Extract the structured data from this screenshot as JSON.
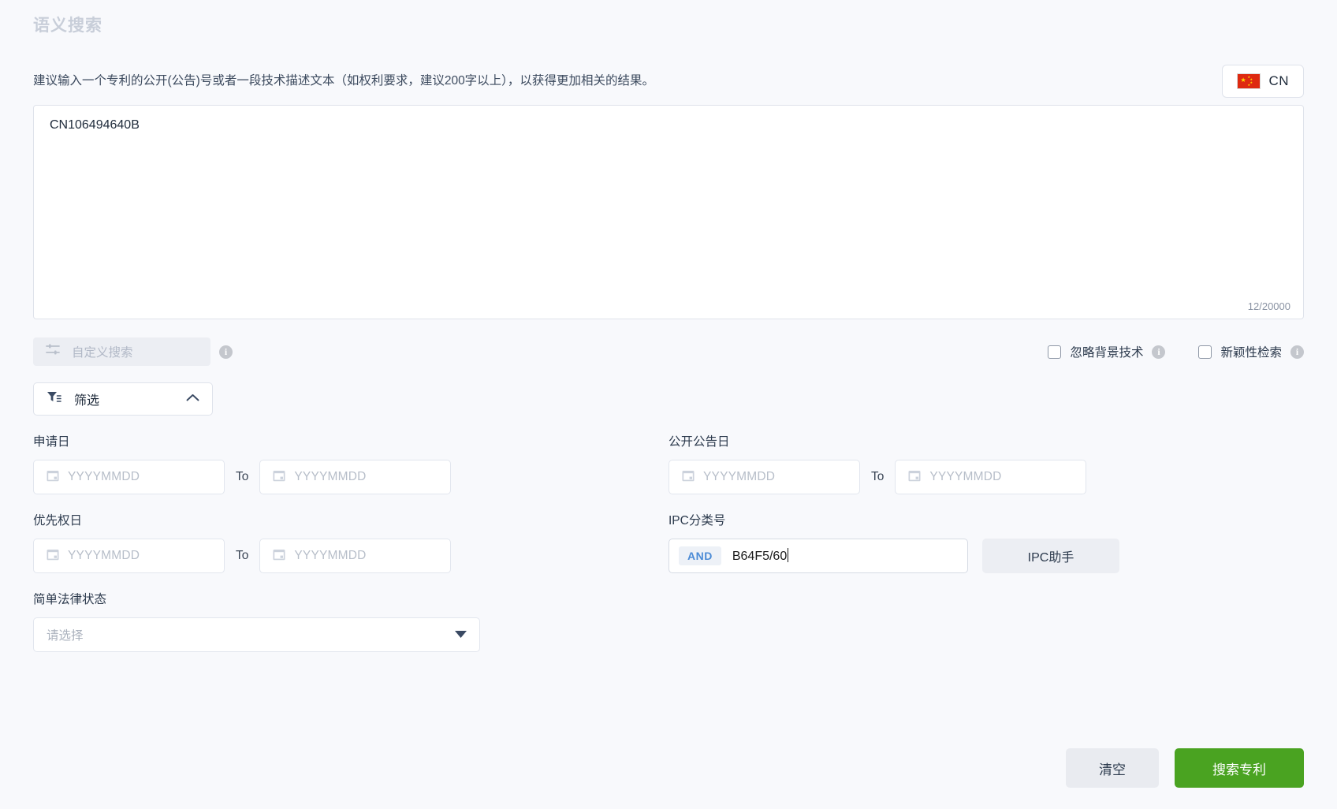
{
  "header": {
    "title": "语义搜索",
    "hint": "建议输入一个专利的公开(公告)号或者一段技术描述文本（如权利要求，建议200字以上），以获得更加相关的结果。",
    "language_button": {
      "label": "CN",
      "flag": "cn-flag-icon"
    }
  },
  "query": {
    "value": "CN106494640B",
    "placeholder": "",
    "char_count": "12/20000",
    "max_chars": 20000,
    "current_chars": 12
  },
  "options": {
    "custom_search": {
      "label": "自定义搜索",
      "icon": "sliders-icon",
      "info_icon": "info-icon"
    },
    "checkboxes": [
      {
        "label": "忽略背景技术",
        "checked": false,
        "info_icon": "info-icon"
      },
      {
        "label": "新颖性检索",
        "checked": false,
        "info_icon": "info-icon"
      }
    ]
  },
  "filter_toggle": {
    "label": "筛选",
    "icon": "funnel-icon",
    "chevron": "chevron-up-icon",
    "expanded": true
  },
  "filters": {
    "application_date": {
      "label": "申请日",
      "from_placeholder": "YYYYMMDD",
      "from_value": "",
      "to_label": "To",
      "to_placeholder": "YYYYMMDD",
      "to_value": ""
    },
    "publication_date": {
      "label": "公开公告日",
      "from_placeholder": "YYYYMMDD",
      "from_value": "",
      "to_label": "To",
      "to_placeholder": "YYYYMMDD",
      "to_value": ""
    },
    "priority_date": {
      "label": "优先权日",
      "from_placeholder": "YYYYMMDD",
      "from_value": "",
      "to_label": "To",
      "to_placeholder": "YYYYMMDD",
      "to_value": ""
    },
    "ipc": {
      "label": "IPC分类号",
      "operator": "AND",
      "value": "B64F5/60",
      "helper_button": "IPC助手"
    },
    "legal_status": {
      "label": "简单法律状态",
      "placeholder": "请选择",
      "value": ""
    }
  },
  "actions": {
    "clear_label": "清空",
    "search_label": "搜索专利"
  },
  "colors": {
    "background": "#f8f9fc",
    "primary_green": "#4aa321",
    "title_gray": "#c8ced9",
    "text_dark": "#2c3a4d",
    "placeholder": "#b7bec9",
    "and_tag_blue": "#4b8bd6",
    "flag_red": "#de2910"
  }
}
